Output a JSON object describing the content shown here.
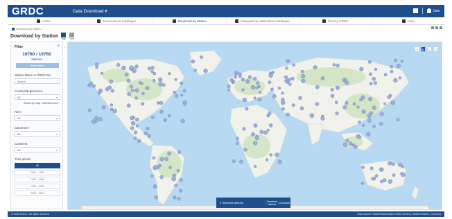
{
  "header": {
    "logo": "GRDC",
    "app_title": "Data Download ▾",
    "user_label": "User"
  },
  "nav": {
    "tabs": [
      {
        "label": "Home",
        "icon": "home-icon"
      },
      {
        "label": "Download by Catalogue",
        "icon": "globe-icon"
      },
      {
        "label": "Download by Station",
        "icon": "pin-icon"
      },
      {
        "label": "Download by Watershed Catalogue",
        "icon": "layers-icon"
      },
      {
        "label": "Privacy GRDC",
        "icon": "globe-icon"
      },
      {
        "label": "Help",
        "icon": "question-icon"
      }
    ],
    "active_index": 2
  },
  "breadcrumb": "Download by Station",
  "page": {
    "title": "Download by Station",
    "view_map": "Map",
    "view_table": "Table"
  },
  "filters": {
    "heading": "Filter",
    "count": "10760 / 10760",
    "count_sub": "stations",
    "reset_label": "Reset filters",
    "station_name_label": "Station Name or GRDC-No.",
    "station_name_placeholder": "Search",
    "country_label": "Country/Region/Area",
    "country_value": "All",
    "country_link": "Select by map / selected area",
    "river_label": "River",
    "river_value": "All",
    "catchment_label": "Catchment",
    "catchment_value": "All",
    "continent_label": "Continent",
    "continent_value": "All",
    "period_label": "Time period",
    "period_options": [
      "All",
      "1800 - 1900",
      "1900 - 1950",
      "1950 - 2000",
      "2000 - 2024"
    ],
    "period_selected": 0
  },
  "map_controls": [
    "+",
    "M",
    "L",
    "?"
  ],
  "download_bar": {
    "selection": "0 Selected stations",
    "action1": "Download stations",
    "action2": "Download"
  },
  "footer": {
    "left": "© 2024 GRDC | All rights reserved",
    "right": "Data source: Global Runoff Data Centre (GRDC), 56068 Koblenz, Germany"
  },
  "colors": {
    "brand": "#1f4e8c",
    "ocean": "#b7d9f2",
    "land": "#f2f2ec",
    "vegetation": "#cfe5bf",
    "station": "#9db0d8"
  }
}
